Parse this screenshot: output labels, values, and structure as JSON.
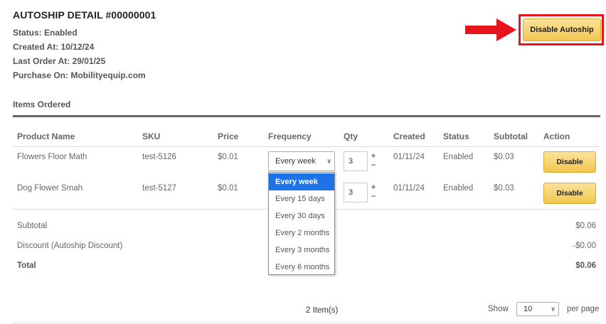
{
  "header": {
    "title": "AUTOSHIP DETAIL #00000001",
    "status": "Status: Enabled",
    "created": "Created At: 10/12/24",
    "last_order": "Last Order At: 29/01/25",
    "purchase_on": "Purchase On: Mobilityequip.com",
    "disable_button": "Disable Autoship"
  },
  "section": {
    "title": "Items Ordered"
  },
  "table": {
    "headers": [
      "Product Name",
      "SKU",
      "Price",
      "Frequency",
      "Qty",
      "Created",
      "Status",
      "Subtotal",
      "Action"
    ],
    "rows": [
      {
        "name": "Flowers Floor Math",
        "sku": "test-5126",
        "price": "$0.01",
        "frequency": "Every week",
        "qty": "3",
        "created": "01/11/24",
        "status": "Enabled",
        "subtotal": "$0.03",
        "action": "Disable"
      },
      {
        "name": "Dog Flower Smah",
        "sku": "test-5127",
        "price": "$0.01",
        "frequency": "",
        "qty": "3",
        "created": "01/11/24",
        "status": "Enabled",
        "subtotal": "$0.03",
        "action": "Disable"
      }
    ]
  },
  "frequency_options": [
    "Every week",
    "Every 15 days",
    "Every 30 days",
    "Every 2 months",
    "Every 3 months",
    "Every 6 months"
  ],
  "totals": {
    "subtotal_label": "Subtotal",
    "subtotal_value": "$0.06",
    "discount_label": "Discount (Autoship Discount)",
    "discount_value": "-$0.00",
    "total_label": "Total",
    "total_value": "$0.06"
  },
  "footer": {
    "item_count": "2 Item(s)",
    "show_label": "Show",
    "per_page_value": "10",
    "per_page_label": "per page"
  },
  "colors": {
    "highlight": "#e8141b",
    "button_gold": "#f2c74f",
    "selected_option": "#1e73e8"
  }
}
